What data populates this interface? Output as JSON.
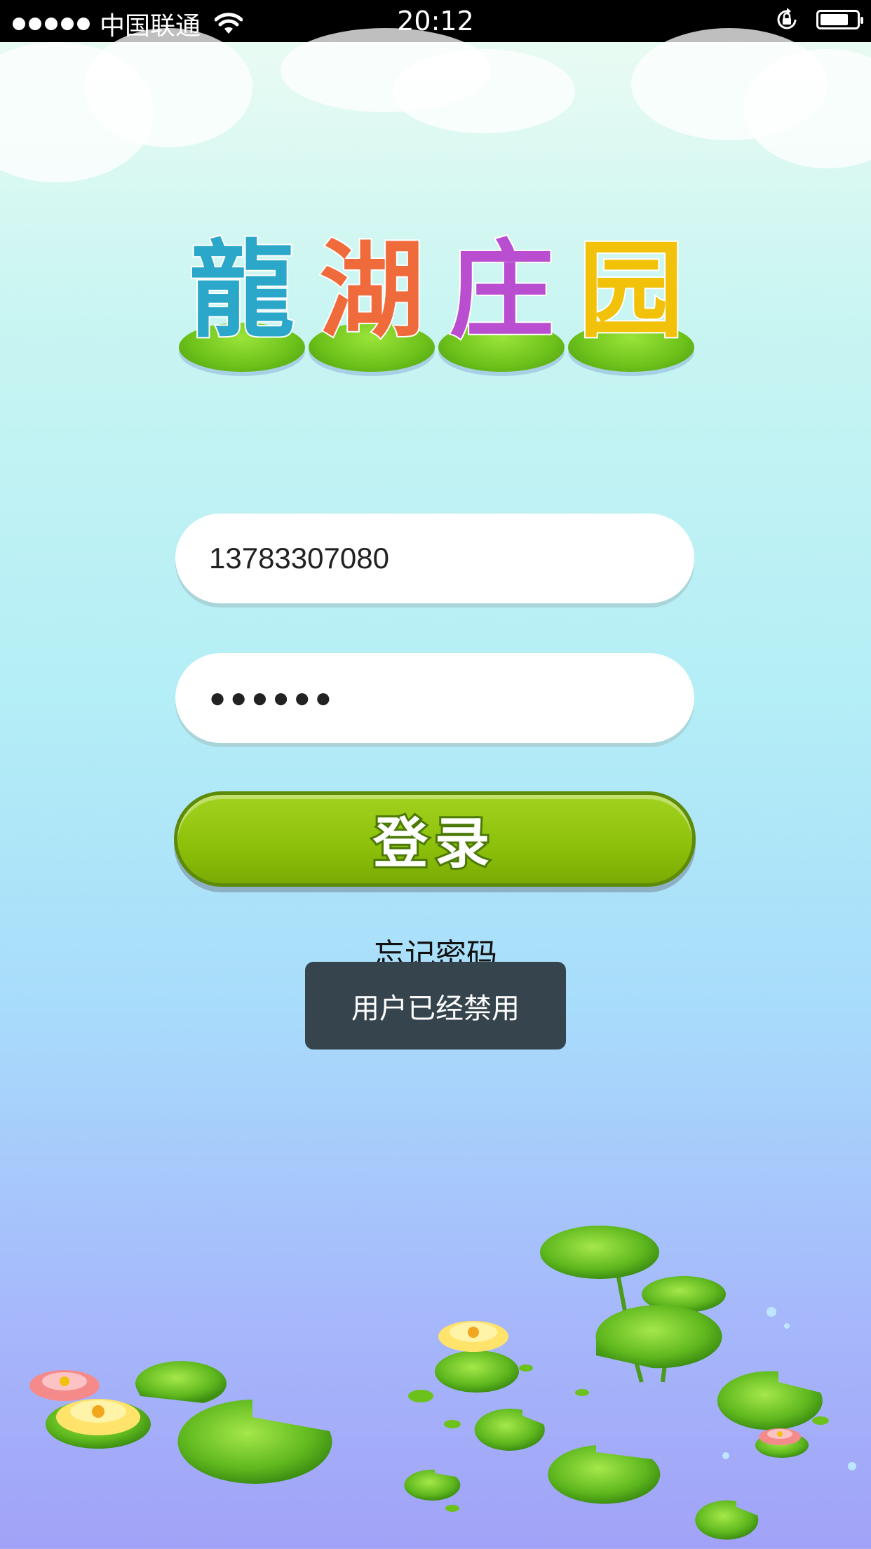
{
  "status_bar": {
    "carrier": "中国联通",
    "time": "20:12",
    "icons": [
      "signal-dots-icon",
      "wifi-icon",
      "rotation-lock-icon",
      "battery-icon"
    ]
  },
  "logo": {
    "chars": [
      "龍",
      "湖",
      "庄",
      "园"
    ],
    "colors": [
      "#2aa7c9",
      "#f06b3c",
      "#b94fd0",
      "#f2c20a"
    ]
  },
  "login_form": {
    "phone_value": "13783307080",
    "password_mask": "●●●●●●",
    "login_label": "登录",
    "forgot_label": "忘记密码"
  },
  "toast": {
    "message": "用户已经禁用"
  },
  "colors": {
    "button_green": "#8cc00a",
    "toast_bg": "#36454d"
  }
}
